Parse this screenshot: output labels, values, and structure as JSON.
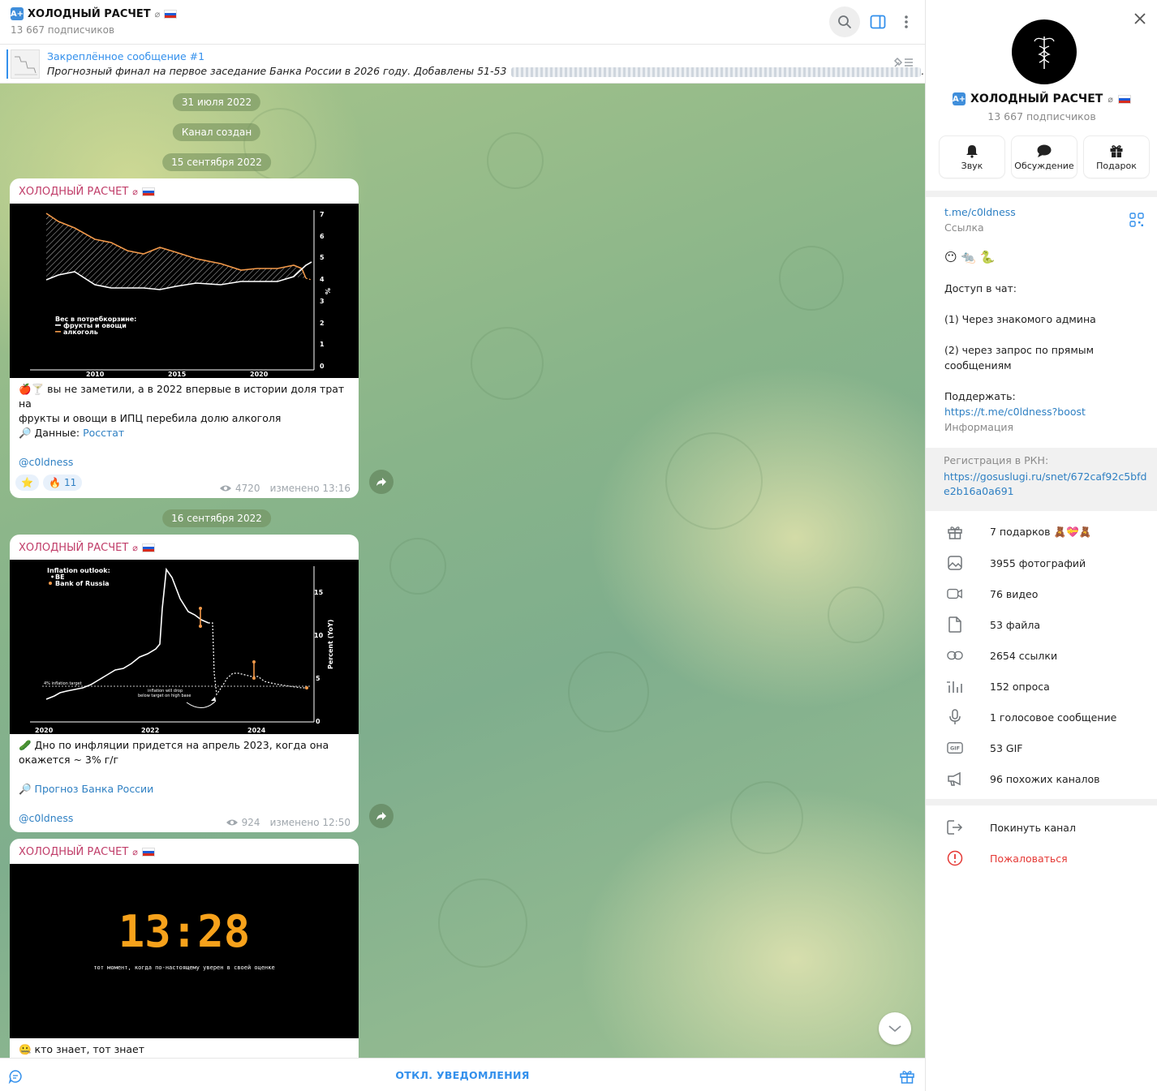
{
  "header": {
    "badge": "A+",
    "title": "ХОЛОДНЫЙ РАСЧЕТ",
    "muted_glyph": "⌀",
    "subscribers": "13 667 подписчиков",
    "icons": [
      "search-icon",
      "side-panel-icon",
      "more-vertical-icon"
    ]
  },
  "pinned": {
    "title": "Закреплённое сообщение #1",
    "text": "Прогнозный финал на первое заседание Банка России в 2026 году. Добавлены 51-53",
    "ellipsis": "..."
  },
  "dates": [
    "31 июля 2022",
    "Канал создан",
    "15 сентября 2022",
    "16 сентября 2022"
  ],
  "messages": [
    {
      "author": "ХОЛОДНЫЙ РАСЧЕТ",
      "text_lines": [
        "🍎🍸 вы не заметили, а в 2022 впервые в истории доля трат на",
        "фрукты и овощи в ИПЦ перебила долю алкоголя"
      ],
      "source_prefix": "🔎 Данные: ",
      "source_link": "Росстат",
      "handle": "@c0ldness",
      "reactions": [
        {
          "emoji": "⭐",
          "count": ""
        },
        {
          "emoji": "🔥",
          "count": "11"
        }
      ],
      "views": "4720",
      "edited": "изменено 13:16"
    },
    {
      "author": "ХОЛОДНЫЙ РАСЧЕТ",
      "text_lines": [
        "🥒 Дно по инфляции придется на апрель 2023, когда она",
        "окажется ~ 3% г/г"
      ],
      "source_prefix": "🔎 ",
      "source_link": "Прогноз Банка России",
      "handle": "@c0ldness",
      "views": "924",
      "edited": "изменено 12:50"
    },
    {
      "author": "ХОЛОДНЫЙ РАСЧЕТ",
      "image_big": "13:28",
      "image_caption": "тот момент, когда по-настоящему уверен в своей оценке",
      "text_lines": [
        "🤐 кто знает, тот знает"
      ]
    }
  ],
  "chart1": {
    "legend_title": "Вес в потребкорзине:",
    "legend_items": [
      "фрукты и овощи",
      "алкоголь"
    ],
    "x_ticks": [
      "2010",
      "2015",
      "2020"
    ],
    "y_ticks": [
      "7",
      "6",
      "5",
      "4",
      "3",
      "2",
      "1",
      "0"
    ],
    "y_unit": "%",
    "colors": {
      "fruits": "#ffffff",
      "alcohol": "#f2994a"
    }
  },
  "chart2": {
    "legend_title": "Inflation outlook:",
    "legend_items": [
      "BE",
      "Bank of Russia"
    ],
    "x_ticks": [
      "2020",
      "2022",
      "2024"
    ],
    "y_ticks": [
      "15",
      "10",
      "5",
      "0"
    ],
    "ylabel": "Percent (YoY)",
    "target_label": "4% inflation target",
    "annotation_lines": [
      "inflation will drop",
      "below target on high base"
    ]
  },
  "bottom": {
    "mute_label": "ОТКЛ. УВЕДОМЛЕНИЯ"
  },
  "panel": {
    "name": "ХОЛОДНЫЙ РАСЧЕТ",
    "subscribers": "13 667 подписчиков",
    "actions": [
      {
        "label": "Звук",
        "icon": "bell-icon"
      },
      {
        "label": "Обсуждение",
        "icon": "chat-bubble-icon"
      },
      {
        "label": "Подарок",
        "icon": "gift-icon"
      }
    ],
    "link": "t.me/c0ldness",
    "link_label": "Ссылка",
    "emojis": "😶 🐀 🐍",
    "about": {
      "l1": "Доступ  в чат:",
      "l2": "(1) Через знакомого админа",
      "l3": "(2) через запрос по прямым",
      "l4": "сообщениям",
      "l5": "Поддержать:",
      "boost": "https://t.me/c0ldness?boost",
      "label": "Информация"
    },
    "rkn_label": "Регистрация в РКН:",
    "rkn_link": "https://gosuslugi.ru/snet/672caf92c5bfde2b16a0a691",
    "media_rows": [
      {
        "label": "7 подарков 🧸💝🧸",
        "icon": "gift-icon"
      },
      {
        "label": "3955 фотографий",
        "icon": "photo-icon"
      },
      {
        "label": "76 видео",
        "icon": "video-icon"
      },
      {
        "label": "53 файла",
        "icon": "file-icon"
      },
      {
        "label": "2654 ссылки",
        "icon": "link-icon"
      },
      {
        "label": "152 опроса",
        "icon": "poll-icon"
      },
      {
        "label": "1 голосовое сообщение",
        "icon": "microphone-icon"
      },
      {
        "label": "53 GIF",
        "icon": "gif-icon"
      },
      {
        "label": "96 похожих каналов",
        "icon": "megaphone-icon"
      }
    ],
    "leave": "Покинуть канал",
    "report": "Пожаловаться"
  }
}
